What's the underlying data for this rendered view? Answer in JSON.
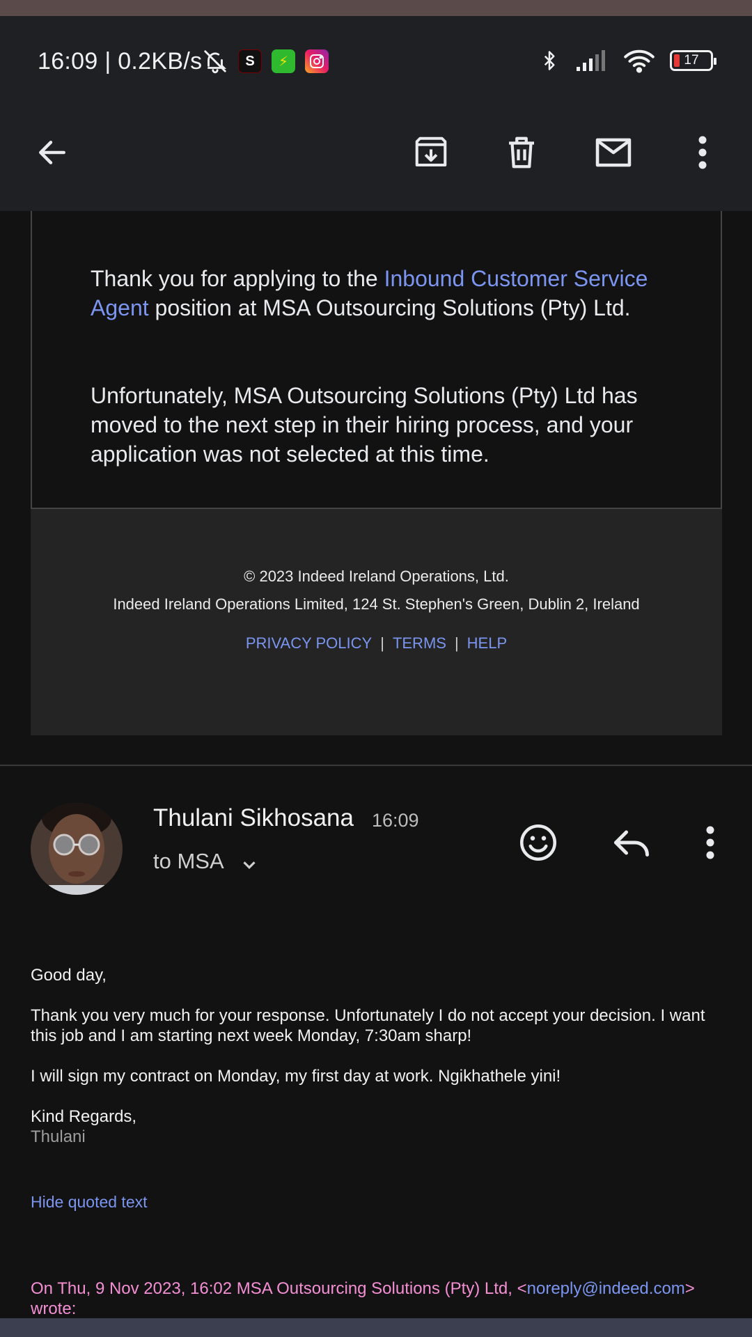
{
  "status": {
    "time_speed": "16:09 | 0.2KB/s",
    "app_s_letter": "S",
    "battery": "17"
  },
  "appbar": {
    "icons": [
      "back-arrow-icon",
      "archive-icon",
      "delete-icon",
      "mark-unread-icon",
      "more-vert-icon"
    ]
  },
  "message1": {
    "p1_before": "Thank you for applying to the ",
    "p1_link": "Inbound Customer Service Agent",
    "p1_after": " position at MSA Outsourcing Solutions (Pty) Ltd.",
    "p2": "Unfortunately, MSA Outsourcing Solutions (Pty) Ltd has moved to the next step in their hiring process, and your application was not selected at this time.",
    "footer": {
      "copyright": "© 2023 Indeed Ireland Operations, Ltd.",
      "address": "Indeed Ireland Operations Limited, 124 St. Stephen's Green, Dublin 2, Ireland",
      "links": [
        "PRIVACY POLICY",
        "TERMS",
        "HELP"
      ],
      "separator": "|"
    }
  },
  "message2": {
    "sender": "Thulani Sikhosana",
    "time": "16:09",
    "to": "to MSA",
    "greeting": "Good day,",
    "para1": "Thank you very much for your response. Unfortunately I do not accept your decision. I want this job and I am starting next week Monday, 7:30am sharp!",
    "para2": "I will sign my contract on Monday, my first day at work. Ngikhathele yini!",
    "closing": "Kind Regards,",
    "signature": "Thulani",
    "hide_quoted": "Hide quoted text",
    "quote_before": "On Thu, 9 Nov 2023, 16:02 MSA Outsourcing Solutions (Pty) Ltd, <",
    "quote_email": "noreply@indeed.com",
    "quote_after": ">",
    "quote_wrote": "wrote:"
  }
}
